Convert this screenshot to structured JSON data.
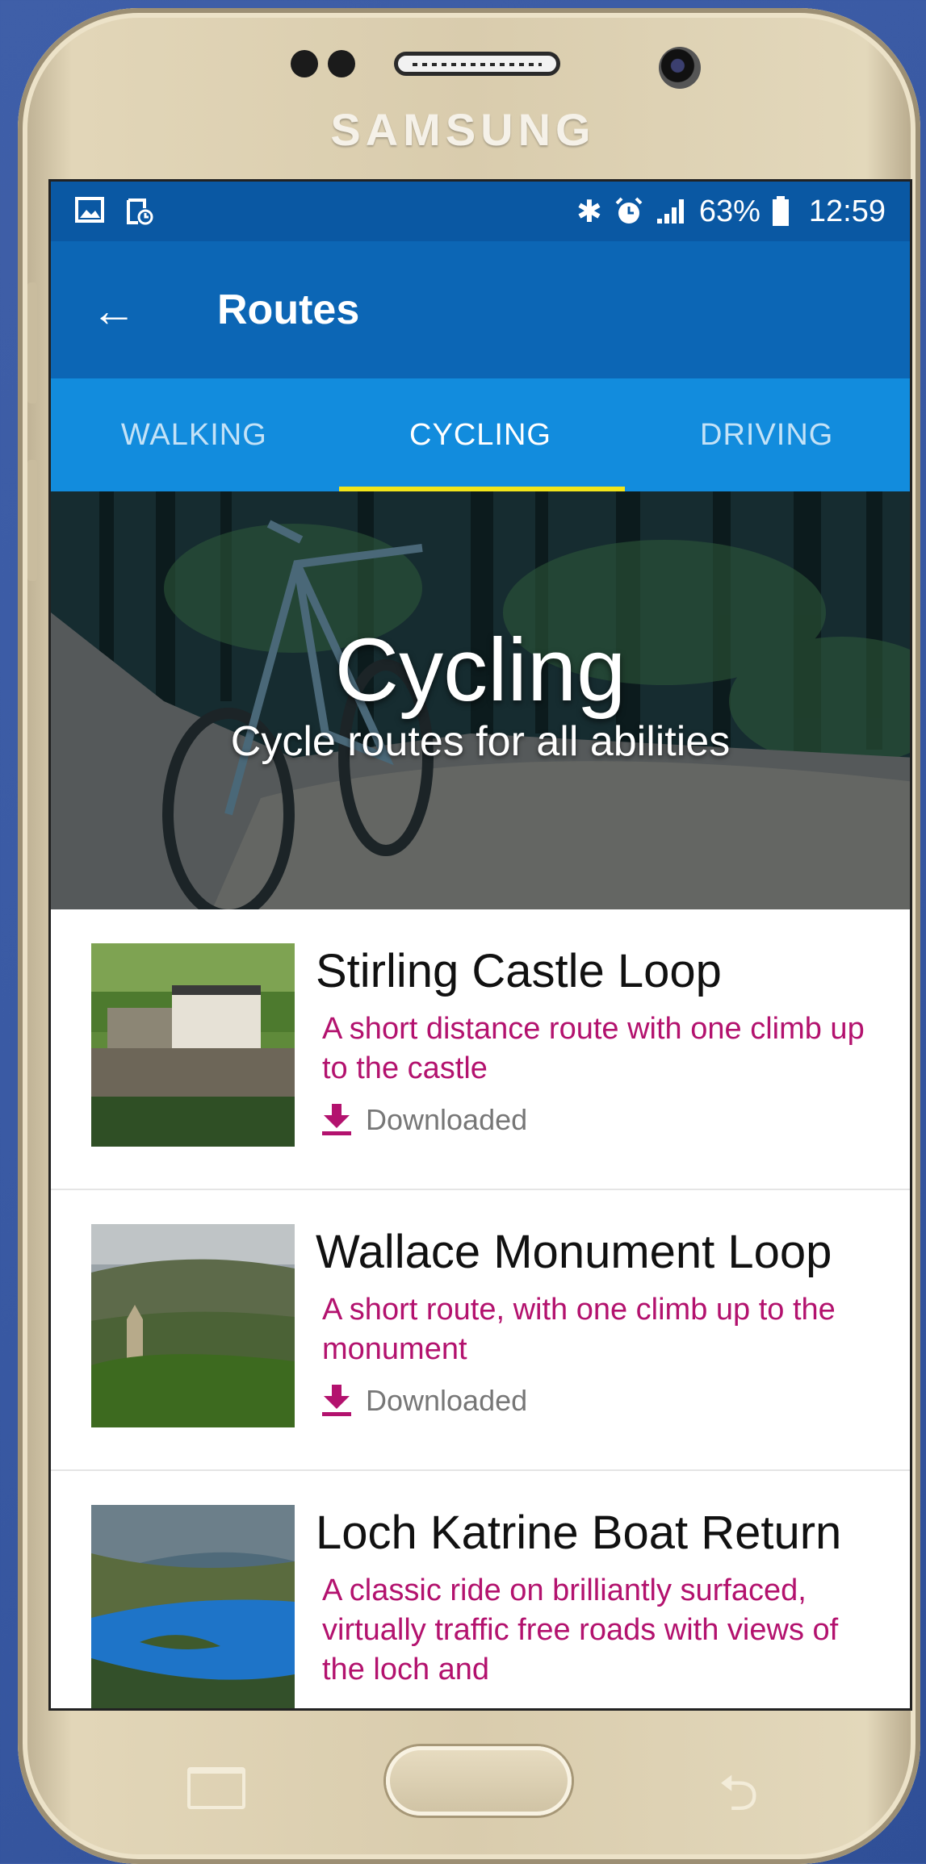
{
  "device": {
    "brand": "SAMSUNG"
  },
  "statusbar": {
    "left_icons": [
      "image-icon",
      "sd-card-icon"
    ],
    "right_icons": [
      "bluetooth-icon",
      "alarm-icon",
      "signal-icon",
      "battery-icon"
    ],
    "battery": "63%",
    "time": "12:59"
  },
  "appbar": {
    "title": "Routes",
    "back_icon": "arrow-left-icon"
  },
  "tabs": [
    {
      "label": "WALKING",
      "active": false
    },
    {
      "label": "CYCLING",
      "active": true
    },
    {
      "label": "DRIVING",
      "active": false
    }
  ],
  "hero": {
    "title": "Cycling",
    "subtitle": "Cycle routes for all abilities"
  },
  "routes": [
    {
      "name": "Stirling Castle Loop",
      "description": "A short distance route with one climb up to the castle",
      "status": "Downloaded"
    },
    {
      "name": "Wallace Monument Loop",
      "description": "A short route, with one climb up to the monument",
      "status": "Downloaded"
    },
    {
      "name": "Loch Katrine Boat Return",
      "description": "A classic ride on brilliantly surfaced, virtually traffic free roads with views of the loch and",
      "status": ""
    }
  ],
  "colors": {
    "statusbar": "#0a58a3",
    "appbar": "#0c66b5",
    "tabs": "#128cdd",
    "indicator": "#f2e51a",
    "accent": "#b3126e"
  }
}
